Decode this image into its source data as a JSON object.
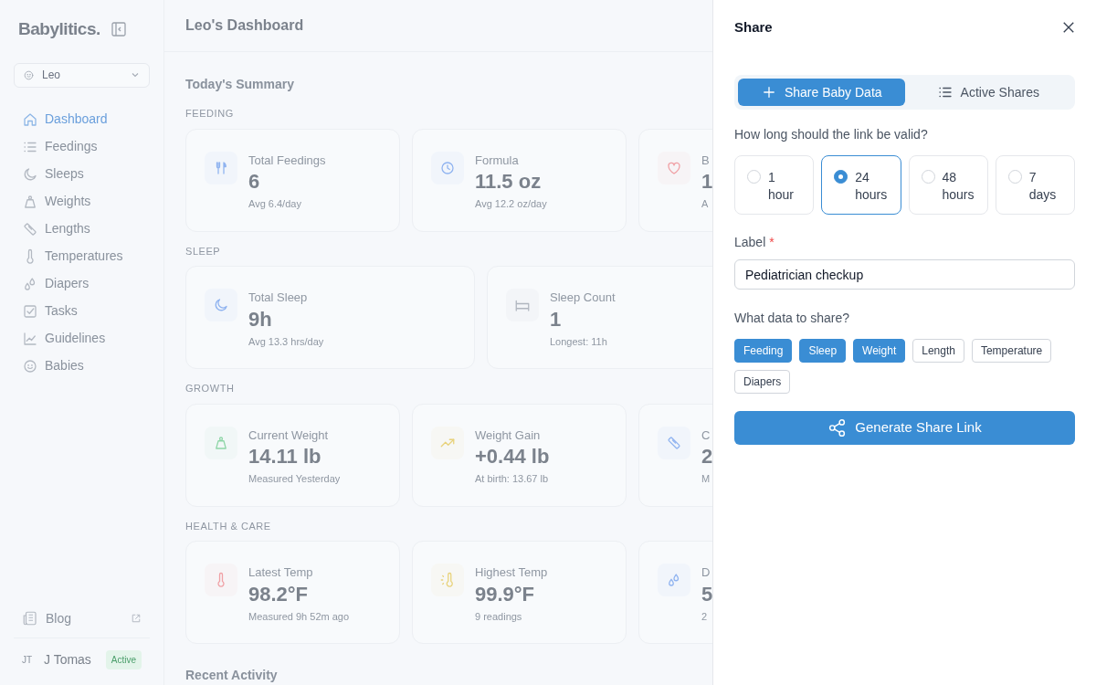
{
  "sidebar": {
    "logo": "Babylitics.",
    "baby_select": {
      "value": "Leo"
    },
    "items": [
      {
        "label": "Dashboard",
        "kind": "home",
        "selected": true
      },
      {
        "label": "Feedings",
        "kind": "list",
        "selected": false
      },
      {
        "label": "Sleeps",
        "kind": "moon",
        "selected": false
      },
      {
        "label": "Weights",
        "kind": "weight",
        "selected": false
      },
      {
        "label": "Lengths",
        "kind": "ruler",
        "selected": false
      },
      {
        "label": "Temperatures",
        "kind": "thermo",
        "selected": false
      },
      {
        "label": "Diapers",
        "kind": "drops",
        "selected": false
      },
      {
        "label": "Tasks",
        "kind": "tasks",
        "selected": false
      },
      {
        "label": "Guidelines",
        "kind": "chart",
        "selected": false
      },
      {
        "label": "Babies",
        "kind": "baby",
        "selected": false
      }
    ],
    "blog": "Blog",
    "user": {
      "initials": "JT",
      "name": "J Tomas",
      "status": "Active"
    }
  },
  "main": {
    "title": "Leo's Dashboard",
    "summary_title": "Today's Summary",
    "sections": [
      {
        "label": "FEEDING",
        "cards": [
          {
            "kind": "utensils",
            "color": "#8fb3f0",
            "title": "Total Feedings",
            "value": "6",
            "sub": "Avg 6.4/day"
          },
          {
            "kind": "clock",
            "color": "#8fb3f0",
            "title": "Formula",
            "value": "11.5 oz",
            "sub": "Avg 12.2 oz/day"
          },
          {
            "kind": "heart",
            "color": "#f0a0a5",
            "title": "B",
            "value": "1",
            "sub": "A"
          }
        ]
      },
      {
        "label": "SLEEP",
        "cards": [
          {
            "kind": "moon",
            "color": "#8fb3f0",
            "title": "Total Sleep",
            "value": "9h",
            "sub": "Avg 13.3 hrs/day"
          },
          {
            "kind": "bed",
            "color": "#b0b6bf",
            "title": "Sleep Count",
            "value": "1",
            "sub": "Longest: 11h"
          }
        ]
      },
      {
        "label": "GROWTH",
        "cards": [
          {
            "kind": "weight",
            "color": "#8fd6a8",
            "title": "Current Weight",
            "value": "14.11 lb",
            "sub": "Measured Yesterday"
          },
          {
            "kind": "trend",
            "color": "#e8d27a",
            "title": "Weight Gain",
            "value": "+0.44 lb",
            "sub": "At birth: 13.67 lb"
          },
          {
            "kind": "ruler",
            "color": "#8fb3f0",
            "title": "C",
            "value": "2",
            "sub": "M"
          }
        ]
      },
      {
        "label": "HEALTH & CARE",
        "cards": [
          {
            "kind": "thermo",
            "color": "#f0a0a5",
            "title": "Latest Temp",
            "value": "98.2°F",
            "sub": "Measured 9h 52m ago"
          },
          {
            "kind": "sunthermo",
            "color": "#e8d27a",
            "title": "Highest Temp",
            "value": "99.9°F",
            "sub": "9 readings"
          },
          {
            "kind": "drops",
            "color": "#8fb3f0",
            "title": "D",
            "value": "5",
            "sub": "2"
          }
        ]
      }
    ],
    "recent_title": "Recent Activity"
  },
  "share_panel": {
    "title": "Share",
    "tabs": [
      {
        "label": "Share Baby Data",
        "kind": "plus",
        "selected": true
      },
      {
        "label": "Active Shares",
        "kind": "list",
        "selected": false
      }
    ],
    "duration_question": "How long should the link be valid?",
    "durations": [
      {
        "number": "1",
        "unit": "hour",
        "selected": false
      },
      {
        "number": "24",
        "unit": "hours",
        "selected": true
      },
      {
        "number": "48",
        "unit": "hours",
        "selected": false
      },
      {
        "number": "7",
        "unit": "days",
        "selected": false
      }
    ],
    "label_field": {
      "label": "Label",
      "required_mark": "*",
      "value": "Pediatrician checkup"
    },
    "data_question": "What data to share?",
    "data_types": [
      {
        "label": "Feeding",
        "selected": true
      },
      {
        "label": "Sleep",
        "selected": true
      },
      {
        "label": "Weight",
        "selected": true
      },
      {
        "label": "Length",
        "selected": false
      },
      {
        "label": "Temperature",
        "selected": false
      },
      {
        "label": "Diapers",
        "selected": false
      }
    ],
    "generate_button": "Generate Share Link"
  }
}
